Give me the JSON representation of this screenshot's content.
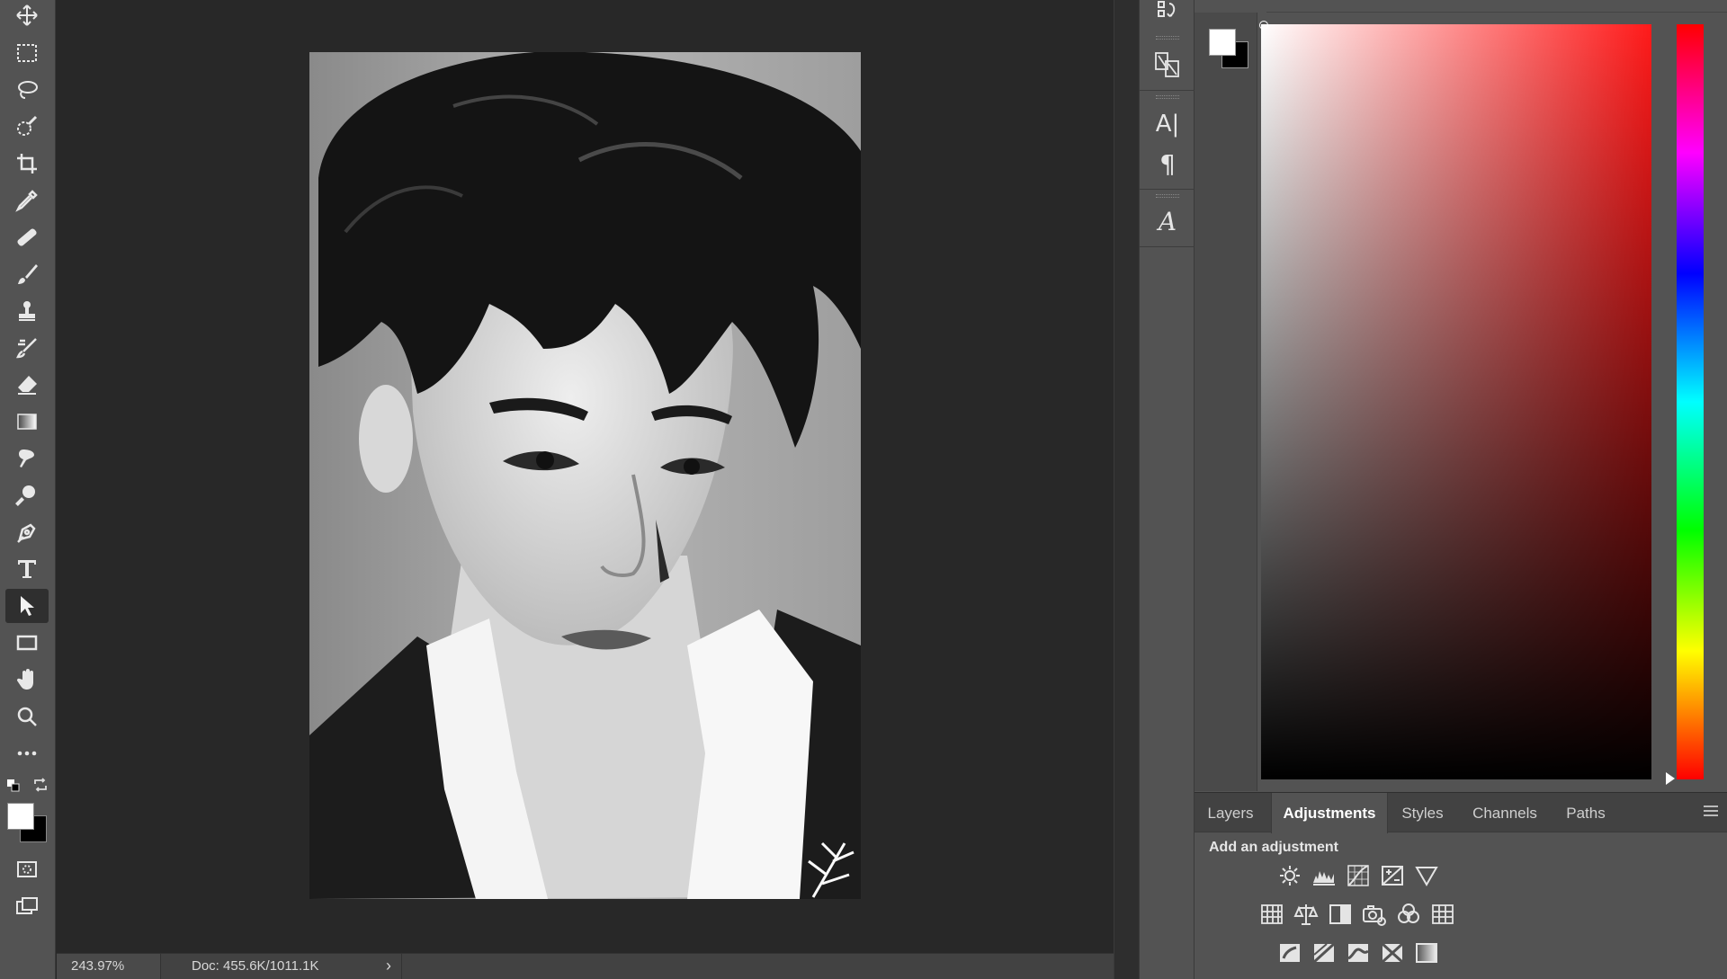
{
  "status": {
    "zoom": "243.97%",
    "doc": "Doc: 455.6K/1011.1K",
    "arrow": "›"
  },
  "tools": [
    "move-tool",
    "rectangular-marquee-tool",
    "lasso-tool",
    "quick-selection-tool",
    "crop-tool",
    "eyedropper-tool",
    "healing-brush-tool",
    "brush-tool",
    "clone-stamp-tool",
    "history-brush-tool",
    "eraser-tool",
    "gradient-tool",
    "smudge-tool",
    "dodge-tool",
    "pen-tool",
    "type-tool",
    "path-selection-tool",
    "rectangle-tool",
    "hand-tool",
    "zoom-tool",
    "more-tools"
  ],
  "dock": {
    "character": "A|",
    "paragraph": "¶",
    "glyphs": "A"
  },
  "colors": {
    "foreground": "#ffffff",
    "background": "#000000",
    "picker_hue": "#ff1a1a"
  },
  "panel": {
    "tabs": [
      "Layers",
      "Adjustments",
      "Styles",
      "Channels",
      "Paths"
    ],
    "active_tab": "Adjustments",
    "adjustments_title": "Add an adjustment",
    "adjustments": [
      [
        "brightness-contrast",
        "levels",
        "curves",
        "exposure",
        "vibrance"
      ],
      [
        "hue-saturation",
        "color-balance",
        "black-white",
        "photo-filter",
        "channel-mixer",
        "color-lookup"
      ],
      [
        "invert",
        "posterize",
        "threshold",
        "selective-color",
        "gradient-map"
      ]
    ]
  }
}
